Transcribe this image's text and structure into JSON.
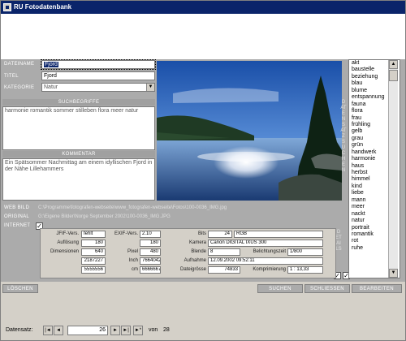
{
  "window": {
    "title": "RU Fotodatenbank"
  },
  "fields": {
    "dateiname_label": "DATEINAME",
    "dateiname_value": "Fjord",
    "titel_label": "TITEL",
    "titel_value": "Fjord",
    "kategorie_label": "KATEGORIE",
    "kategorie_value": "Natur"
  },
  "suchbegriffe": {
    "header": "SUCHBEGRIFFE",
    "text": "harmonie romantik sommer stilleben flora meer natur"
  },
  "kommentar": {
    "header": "KOMMENTAR",
    "text": "Ein Spätsommer Nachmittag am einem idyllischen Fjord in der Nähe Lillehammers"
  },
  "paths": {
    "webbild_label": "WEB BILD",
    "webbild_value": "C:\\Programme\\fotografen-webseite\\www_fotografen-webseite\\Fotos\\100-0036_IMG.jpg",
    "original_label": "ORIGINAL",
    "original_value": "G:\\Eigene Bilder\\Norge September 2002\\100-0036_IMG.JPG",
    "internet_label": "INTERNET"
  },
  "side_labels": {
    "datensatz_vert": "DATENSATZ SUCHEN",
    "details_vert": "DETAILS"
  },
  "keyword_list": {
    "items": [
      "akt",
      "baustelle",
      "beziehung",
      "blau",
      "blume",
      "entspannung",
      "fauna",
      "flora",
      "frau",
      "frühling",
      "gelb",
      "grau",
      "grün",
      "handwerk",
      "harmonie",
      "haus",
      "herbst",
      "himmel",
      "kind",
      "liebe",
      "mann",
      "meer",
      "nackt",
      "natur",
      "portrait",
      "romantik",
      "rot",
      "ruhe"
    ],
    "scroll_up_icon": "▲",
    "scroll_down_icon": "▼"
  },
  "image_info": {
    "jfif_label": "JFIF-Vers.",
    "jfif_value": "fehlt",
    "exif_label": "EXIF-Vers.",
    "exif_value": "2.10",
    "aufloesung_label": "Auflösung",
    "aufloesung_value1": "180",
    "aufloesung_value2": "180",
    "dimensionen_label": "Dimensionen",
    "dimensionen_value1": "640",
    "pixel_label": "Pixel",
    "dimensionen_value2": "480",
    "inch_value1": "2187227",
    "inch_label": "Inch",
    "inch_value2": "7664042",
    "cm_value1": "5555556",
    "cm_label": "cm",
    "cm_value2": "6666667",
    "bits_label": "Bits",
    "bits_value": "24",
    "rgb_value": "RGB",
    "kamera_label": "Kamera",
    "kamera_value": "Canon DIGITAL IXUS 300",
    "blende_label": "Blende",
    "blende_value": "8",
    "belichtung_label": "Belichtungszeit",
    "belichtung_value": "1/800",
    "aufnahme_label": "Aufnahme",
    "aufnahme_value": "12.09.2002 09:52:11",
    "dateigroesse_label": "Dateigrösse",
    "dateigroesse_value": "74833",
    "kompr_label": "Komprimierung",
    "kompr_value": "1 : 13,33"
  },
  "buttons": {
    "loeschen": "LÖSCHEN",
    "suchen": "SUCHEN",
    "schliessen": "SCHLIESSEN",
    "bearbeiten": "BEARBEITEN"
  },
  "navigation": {
    "label": "Datensatz:",
    "current": "26",
    "of_label": "von",
    "total": "28",
    "first_icon": "|◄",
    "prev_icon": "◄",
    "next_icon": "►",
    "last_icon": "►|",
    "new_icon": "►*"
  },
  "checkbox": {
    "mark": "✓"
  }
}
